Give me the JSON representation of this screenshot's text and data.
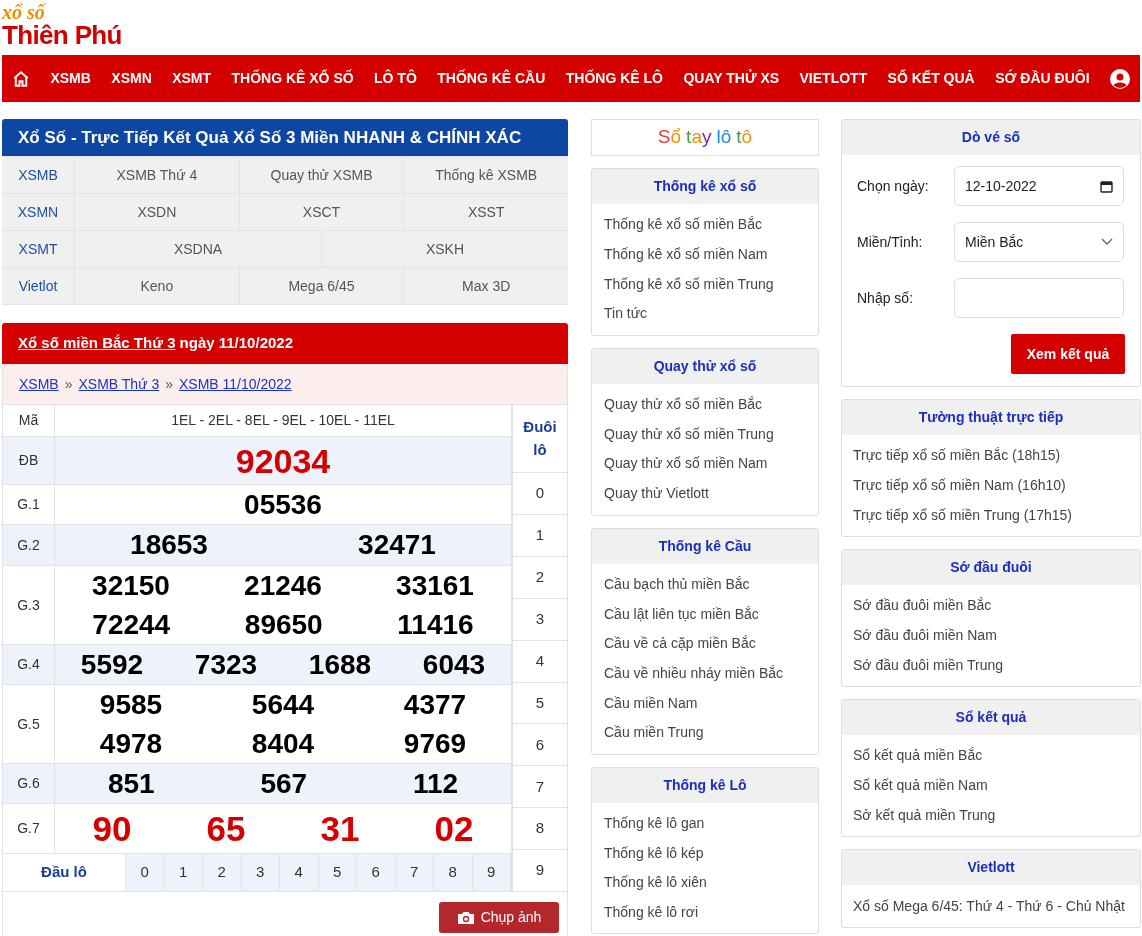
{
  "logo": {
    "top": "xổ số",
    "bottom": "Thiên Phú"
  },
  "nav": [
    "XSMB",
    "XSMN",
    "XSMT",
    "THỐNG KÊ XỔ SỐ",
    "LÔ TÔ",
    "THỐNG KÊ CẦU",
    "THỐNG KÊ LÔ",
    "QUAY THỬ XS",
    "VIETLOTT",
    "SỔ KẾT QUẢ",
    "SỚ ĐẦU ĐUÔI"
  ],
  "links_panel": {
    "title": "Xổ Số - Trực Tiếp Kết Quả Xổ Số 3 Miền NHANH & CHÍNH XÁC",
    "rows": [
      {
        "head": "XSMB",
        "links": [
          "XSMB Thứ 4",
          "Quay thử XSMB",
          "Thống kê XSMB"
        ]
      },
      {
        "head": "XSMN",
        "links": [
          "XSDN",
          "XSCT",
          "XSST"
        ]
      },
      {
        "head": "XSMT",
        "links": [
          "XSDNA",
          "XSKH"
        ]
      },
      {
        "head": "Vietlot",
        "links": [
          "Keno",
          "Mega 6/45",
          "Max 3D"
        ]
      }
    ]
  },
  "results": {
    "title_link": "Xổ số miền Bắc Thứ 3",
    "title_rest": "ngày 11/10/2022",
    "breadcrumb": [
      "XSMB",
      "XSMB Thứ 3",
      "XSMB 11/10/2022"
    ],
    "separator": "»",
    "code_label": "Mã",
    "codes": "1EL - 2EL - 8EL - 9EL - 10EL - 11EL",
    "rows": [
      {
        "label": "ĐB",
        "kind": "special",
        "lines": [
          [
            "92034"
          ]
        ]
      },
      {
        "label": "G.1",
        "kind": "normal",
        "lines": [
          [
            "05536"
          ]
        ]
      },
      {
        "label": "G.2",
        "kind": "normal",
        "lines": [
          [
            "18653",
            "32471"
          ]
        ]
      },
      {
        "label": "G.3",
        "kind": "normal",
        "lines": [
          [
            "32150",
            "21246",
            "33161"
          ],
          [
            "72244",
            "89650",
            "11416"
          ]
        ]
      },
      {
        "label": "G.4",
        "kind": "normal",
        "lines": [
          [
            "5592",
            "7323",
            "1688",
            "6043"
          ]
        ]
      },
      {
        "label": "G.5",
        "kind": "normal",
        "lines": [
          [
            "9585",
            "5644",
            "4377"
          ],
          [
            "4978",
            "8404",
            "9769"
          ]
        ]
      },
      {
        "label": "G.6",
        "kind": "normal",
        "lines": [
          [
            "851",
            "567",
            "112"
          ]
        ]
      },
      {
        "label": "G.7",
        "kind": "special",
        "lines": [
          [
            "90",
            "65",
            "31",
            "02"
          ]
        ]
      }
    ],
    "head_label": "Đầu lô",
    "heads": [
      "0",
      "1",
      "2",
      "3",
      "4",
      "5",
      "6",
      "7",
      "8",
      "9"
    ],
    "tail_label": "Đuôi lô",
    "tails": [
      "0",
      "1",
      "2",
      "3",
      "4",
      "5",
      "6",
      "7",
      "8",
      "9"
    ],
    "capture_button": "Chụp ảnh"
  },
  "notebook_title": [
    {
      "letters": [
        {
          "text": "S",
          "color": "#e53935"
        },
        {
          "text": "ổ",
          "color": "#fb8c00"
        }
      ]
    },
    {
      "letters": [
        {
          "text": "t",
          "color": "#43a047"
        },
        {
          "text": "a",
          "color": "#fb8c00"
        },
        {
          "text": "y",
          "color": "#8e24aa"
        }
      ]
    },
    {
      "letters": [
        {
          "text": "l",
          "color": "#1e88e5"
        },
        {
          "text": "ô",
          "color": "#1e88e5"
        }
      ]
    },
    {
      "letters": [
        {
          "text": "t",
          "color": "#43a047"
        },
        {
          "text": "ô",
          "color": "#fb8c00"
        }
      ]
    }
  ],
  "middle_boxes": [
    {
      "title": "Thống kê xổ số",
      "items": [
        "Thống kê xổ số miền Bắc",
        "Thống kê xổ số miền Nam",
        "Thống kê xổ số miền Trung",
        "Tin tức"
      ]
    },
    {
      "title": "Quay thử xổ số",
      "items": [
        "Quay thử xổ số miền Bắc",
        "Quay thử xổ số miền Trung",
        "Quay thử xổ số miền Nam",
        "Quay thử Vietlott"
      ]
    },
    {
      "title": "Thống kê Cầu",
      "items": [
        "Cầu bạch thủ miền Bắc",
        "Cầu lật liên tục miền Bắc",
        "Cầu về cả cặp miền Bắc",
        "Cầu về nhiều nháy miền Bắc",
        "Cầu miền Nam",
        "Cầu miền Trung"
      ]
    },
    {
      "title": "Thống kê Lô",
      "items": [
        "Thống kê lô gan",
        "Thống kê lô kép",
        "Thống kê lô xiên",
        "Thống kê lô rơi"
      ]
    }
  ],
  "ticket_check": {
    "title": "Dò vé số",
    "date_label": "Chọn ngày:",
    "date_value": "12-10-2022",
    "region_label": "Miền/Tỉnh:",
    "region_value": "Miền Bắc",
    "number_label": "Nhập số:",
    "button": "Xem kết quả"
  },
  "right_boxes": [
    {
      "title": "Tường thuật trực tiếp",
      "items": [
        "Trực tiếp xổ số miền Bắc (18h15)",
        "Trực tiếp xổ số miền Nam (16h10)",
        "Trực tiếp xổ số miền Trung (17h15)"
      ]
    },
    {
      "title": "Sớ đầu đuôi",
      "items": [
        "Sớ đầu đuôi miền Bắc",
        "Sớ đầu đuôi miền Nam",
        "Sớ đầu đuôi miền Trung"
      ]
    },
    {
      "title": "Sổ kết quả",
      "items": [
        "Sổ kết quả miền Bắc",
        "Sổ kết quả miền Nam",
        "Sở kết quả miền Trung"
      ]
    },
    {
      "title": "Vietlott",
      "items": [
        "Xổ số Mega 6/45: Thứ 4 - Thứ 6 - Chủ Nhật"
      ]
    }
  ]
}
